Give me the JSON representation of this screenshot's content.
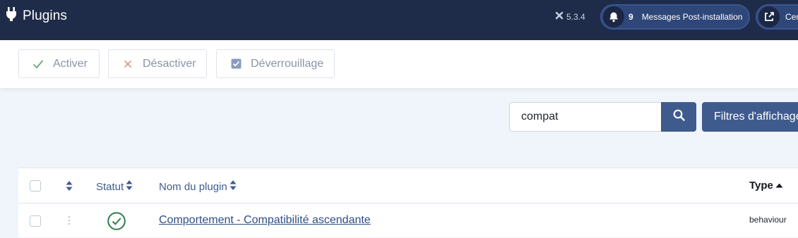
{
  "header": {
    "title": "Plugins",
    "version": "5.3.4",
    "messages": {
      "count": "9",
      "label": "Messages Post-installation"
    },
    "center_label": "Cen"
  },
  "toolbar": {
    "activate_label": "Activer",
    "deactivate_label": "Désactiver",
    "unlock_label": "Déverrouillage"
  },
  "search": {
    "value": "compat",
    "filter_label": "Filtres d'affichage"
  },
  "table": {
    "columns": {
      "status": "Statut",
      "name": "Nom du plugin",
      "type": "Type"
    },
    "rows": [
      {
        "name": "Comportement - Compatibilité ascendante",
        "type": "behaviour",
        "status": "enabled"
      }
    ]
  },
  "colors": {
    "header_bg": "#1f2c49",
    "primary": "#3f5b8e",
    "success": "#2e7d4c"
  }
}
